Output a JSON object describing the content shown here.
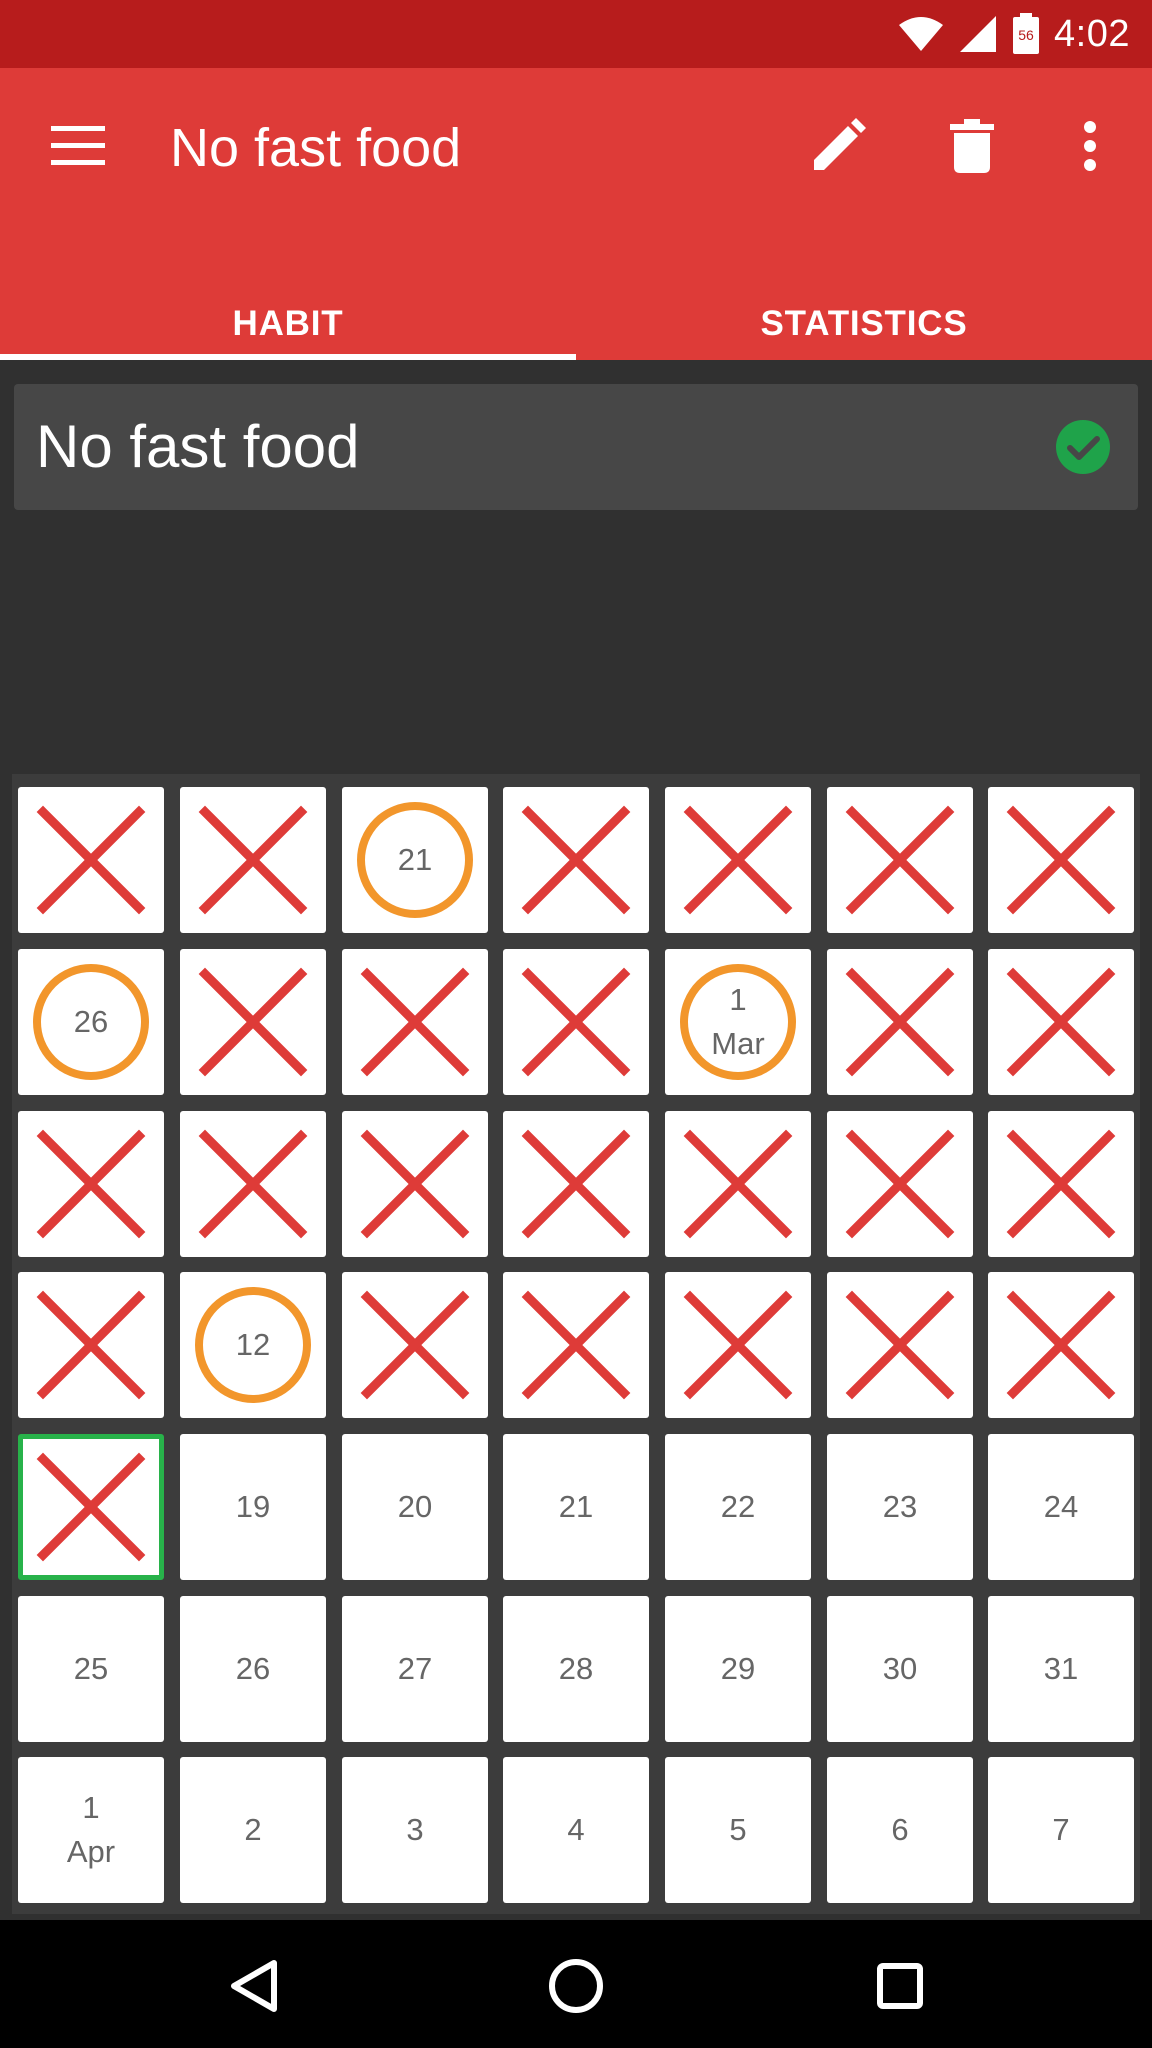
{
  "status_bar": {
    "time": "4:02",
    "battery_level": "56"
  },
  "app_bar": {
    "title": "No fast food",
    "menu_icon": "hamburger-menu-icon",
    "edit_icon": "pencil-icon",
    "delete_icon": "trash-icon",
    "more_icon": "more-vertical-icon"
  },
  "tabs": [
    {
      "label": "HABIT",
      "selected": true
    },
    {
      "label": "STATISTICS",
      "selected": false
    }
  ],
  "habit": {
    "name": "No fast food",
    "status_icon": "check-circle-icon",
    "status_color": "#1fa34a"
  },
  "colors": {
    "primary": "#de3b38",
    "status_bar": "#b71c1c",
    "cross": "#de3b38",
    "circle": "#f2962b",
    "today_border": "#28b24a"
  },
  "calendar": {
    "rows": [
      [
        {
          "label": "",
          "mark": "x"
        },
        {
          "label": "",
          "mark": "x"
        },
        {
          "label": "21",
          "mark": "o"
        },
        {
          "label": "",
          "mark": "x"
        },
        {
          "label": "",
          "mark": "x"
        },
        {
          "label": "",
          "mark": "x"
        },
        {
          "label": "",
          "mark": "x"
        }
      ],
      [
        {
          "label": "26",
          "mark": "o"
        },
        {
          "label": "",
          "mark": "x"
        },
        {
          "label": "",
          "mark": "x"
        },
        {
          "label": "",
          "mark": "x"
        },
        {
          "label": "1",
          "sub": "Mar",
          "mark": "o"
        },
        {
          "label": "",
          "mark": "x"
        },
        {
          "label": "",
          "mark": "x"
        }
      ],
      [
        {
          "label": "",
          "mark": "x"
        },
        {
          "label": "",
          "mark": "x"
        },
        {
          "label": "",
          "mark": "x"
        },
        {
          "label": "",
          "mark": "x"
        },
        {
          "label": "",
          "mark": "x"
        },
        {
          "label": "",
          "mark": "x"
        },
        {
          "label": "",
          "mark": "x"
        }
      ],
      [
        {
          "label": "",
          "mark": "x"
        },
        {
          "label": "12",
          "mark": "o"
        },
        {
          "label": "",
          "mark": "x"
        },
        {
          "label": "",
          "mark": "x"
        },
        {
          "label": "",
          "mark": "x"
        },
        {
          "label": "",
          "mark": "x"
        },
        {
          "label": "",
          "mark": "x"
        }
      ],
      [
        {
          "label": "",
          "mark": "x",
          "today": true
        },
        {
          "label": "19",
          "mark": ""
        },
        {
          "label": "20",
          "mark": ""
        },
        {
          "label": "21",
          "mark": ""
        },
        {
          "label": "22",
          "mark": ""
        },
        {
          "label": "23",
          "mark": ""
        },
        {
          "label": "24",
          "mark": ""
        }
      ],
      [
        {
          "label": "25",
          "mark": ""
        },
        {
          "label": "26",
          "mark": ""
        },
        {
          "label": "27",
          "mark": ""
        },
        {
          "label": "28",
          "mark": ""
        },
        {
          "label": "29",
          "mark": ""
        },
        {
          "label": "30",
          "mark": ""
        },
        {
          "label": "31",
          "mark": ""
        }
      ],
      [
        {
          "label": "1",
          "sub": "Apr",
          "mark": ""
        },
        {
          "label": "2",
          "mark": ""
        },
        {
          "label": "3",
          "mark": ""
        },
        {
          "label": "4",
          "mark": ""
        },
        {
          "label": "5",
          "mark": ""
        },
        {
          "label": "6",
          "mark": ""
        },
        {
          "label": "7",
          "mark": ""
        }
      ]
    ]
  },
  "nav_bar": {
    "back_icon": "back-triangle-icon",
    "home_icon": "home-circle-icon",
    "recents_icon": "recents-square-icon"
  }
}
